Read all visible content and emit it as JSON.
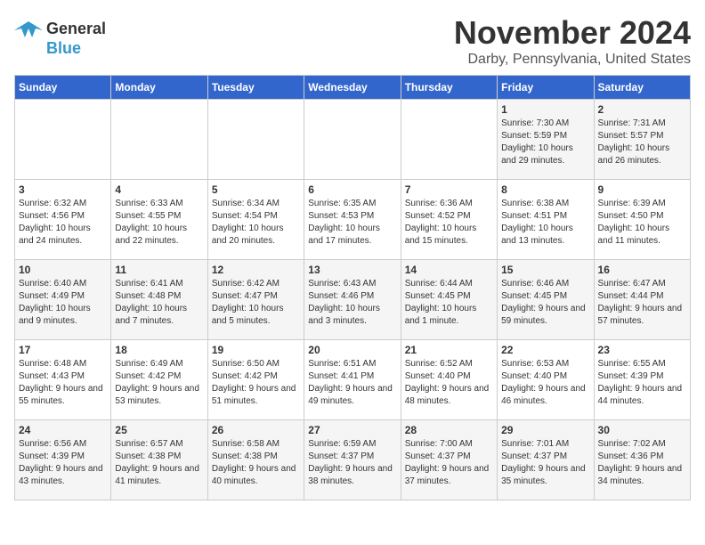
{
  "logo": {
    "line1": "General",
    "line2": "Blue"
  },
  "title": "November 2024",
  "location": "Darby, Pennsylvania, United States",
  "weekdays": [
    "Sunday",
    "Monday",
    "Tuesday",
    "Wednesday",
    "Thursday",
    "Friday",
    "Saturday"
  ],
  "weeks": [
    [
      {
        "day": "",
        "sunrise": "",
        "sunset": "",
        "daylight": ""
      },
      {
        "day": "",
        "sunrise": "",
        "sunset": "",
        "daylight": ""
      },
      {
        "day": "",
        "sunrise": "",
        "sunset": "",
        "daylight": ""
      },
      {
        "day": "",
        "sunrise": "",
        "sunset": "",
        "daylight": ""
      },
      {
        "day": "",
        "sunrise": "",
        "sunset": "",
        "daylight": ""
      },
      {
        "day": "1",
        "sunrise": "Sunrise: 7:30 AM",
        "sunset": "Sunset: 5:59 PM",
        "daylight": "Daylight: 10 hours and 29 minutes."
      },
      {
        "day": "2",
        "sunrise": "Sunrise: 7:31 AM",
        "sunset": "Sunset: 5:57 PM",
        "daylight": "Daylight: 10 hours and 26 minutes."
      }
    ],
    [
      {
        "day": "3",
        "sunrise": "Sunrise: 6:32 AM",
        "sunset": "Sunset: 4:56 PM",
        "daylight": "Daylight: 10 hours and 24 minutes."
      },
      {
        "day": "4",
        "sunrise": "Sunrise: 6:33 AM",
        "sunset": "Sunset: 4:55 PM",
        "daylight": "Daylight: 10 hours and 22 minutes."
      },
      {
        "day": "5",
        "sunrise": "Sunrise: 6:34 AM",
        "sunset": "Sunset: 4:54 PM",
        "daylight": "Daylight: 10 hours and 20 minutes."
      },
      {
        "day": "6",
        "sunrise": "Sunrise: 6:35 AM",
        "sunset": "Sunset: 4:53 PM",
        "daylight": "Daylight: 10 hours and 17 minutes."
      },
      {
        "day": "7",
        "sunrise": "Sunrise: 6:36 AM",
        "sunset": "Sunset: 4:52 PM",
        "daylight": "Daylight: 10 hours and 15 minutes."
      },
      {
        "day": "8",
        "sunrise": "Sunrise: 6:38 AM",
        "sunset": "Sunset: 4:51 PM",
        "daylight": "Daylight: 10 hours and 13 minutes."
      },
      {
        "day": "9",
        "sunrise": "Sunrise: 6:39 AM",
        "sunset": "Sunset: 4:50 PM",
        "daylight": "Daylight: 10 hours and 11 minutes."
      }
    ],
    [
      {
        "day": "10",
        "sunrise": "Sunrise: 6:40 AM",
        "sunset": "Sunset: 4:49 PM",
        "daylight": "Daylight: 10 hours and 9 minutes."
      },
      {
        "day": "11",
        "sunrise": "Sunrise: 6:41 AM",
        "sunset": "Sunset: 4:48 PM",
        "daylight": "Daylight: 10 hours and 7 minutes."
      },
      {
        "day": "12",
        "sunrise": "Sunrise: 6:42 AM",
        "sunset": "Sunset: 4:47 PM",
        "daylight": "Daylight: 10 hours and 5 minutes."
      },
      {
        "day": "13",
        "sunrise": "Sunrise: 6:43 AM",
        "sunset": "Sunset: 4:46 PM",
        "daylight": "Daylight: 10 hours and 3 minutes."
      },
      {
        "day": "14",
        "sunrise": "Sunrise: 6:44 AM",
        "sunset": "Sunset: 4:45 PM",
        "daylight": "Daylight: 10 hours and 1 minute."
      },
      {
        "day": "15",
        "sunrise": "Sunrise: 6:46 AM",
        "sunset": "Sunset: 4:45 PM",
        "daylight": "Daylight: 9 hours and 59 minutes."
      },
      {
        "day": "16",
        "sunrise": "Sunrise: 6:47 AM",
        "sunset": "Sunset: 4:44 PM",
        "daylight": "Daylight: 9 hours and 57 minutes."
      }
    ],
    [
      {
        "day": "17",
        "sunrise": "Sunrise: 6:48 AM",
        "sunset": "Sunset: 4:43 PM",
        "daylight": "Daylight: 9 hours and 55 minutes."
      },
      {
        "day": "18",
        "sunrise": "Sunrise: 6:49 AM",
        "sunset": "Sunset: 4:42 PM",
        "daylight": "Daylight: 9 hours and 53 minutes."
      },
      {
        "day": "19",
        "sunrise": "Sunrise: 6:50 AM",
        "sunset": "Sunset: 4:42 PM",
        "daylight": "Daylight: 9 hours and 51 minutes."
      },
      {
        "day": "20",
        "sunrise": "Sunrise: 6:51 AM",
        "sunset": "Sunset: 4:41 PM",
        "daylight": "Daylight: 9 hours and 49 minutes."
      },
      {
        "day": "21",
        "sunrise": "Sunrise: 6:52 AM",
        "sunset": "Sunset: 4:40 PM",
        "daylight": "Daylight: 9 hours and 48 minutes."
      },
      {
        "day": "22",
        "sunrise": "Sunrise: 6:53 AM",
        "sunset": "Sunset: 4:40 PM",
        "daylight": "Daylight: 9 hours and 46 minutes."
      },
      {
        "day": "23",
        "sunrise": "Sunrise: 6:55 AM",
        "sunset": "Sunset: 4:39 PM",
        "daylight": "Daylight: 9 hours and 44 minutes."
      }
    ],
    [
      {
        "day": "24",
        "sunrise": "Sunrise: 6:56 AM",
        "sunset": "Sunset: 4:39 PM",
        "daylight": "Daylight: 9 hours and 43 minutes."
      },
      {
        "day": "25",
        "sunrise": "Sunrise: 6:57 AM",
        "sunset": "Sunset: 4:38 PM",
        "daylight": "Daylight: 9 hours and 41 minutes."
      },
      {
        "day": "26",
        "sunrise": "Sunrise: 6:58 AM",
        "sunset": "Sunset: 4:38 PM",
        "daylight": "Daylight: 9 hours and 40 minutes."
      },
      {
        "day": "27",
        "sunrise": "Sunrise: 6:59 AM",
        "sunset": "Sunset: 4:37 PM",
        "daylight": "Daylight: 9 hours and 38 minutes."
      },
      {
        "day": "28",
        "sunrise": "Sunrise: 7:00 AM",
        "sunset": "Sunset: 4:37 PM",
        "daylight": "Daylight: 9 hours and 37 minutes."
      },
      {
        "day": "29",
        "sunrise": "Sunrise: 7:01 AM",
        "sunset": "Sunset: 4:37 PM",
        "daylight": "Daylight: 9 hours and 35 minutes."
      },
      {
        "day": "30",
        "sunrise": "Sunrise: 7:02 AM",
        "sunset": "Sunset: 4:36 PM",
        "daylight": "Daylight: 9 hours and 34 minutes."
      }
    ]
  ]
}
